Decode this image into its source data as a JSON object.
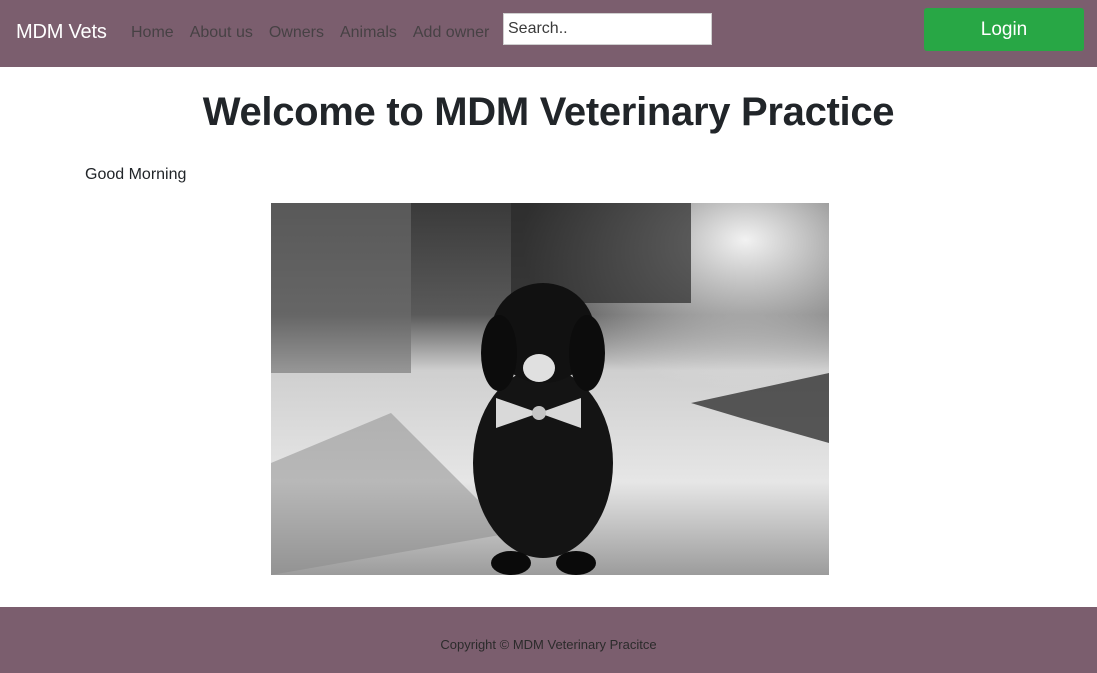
{
  "navbar": {
    "brand": "MDM Vets",
    "links": [
      {
        "label": "Home"
      },
      {
        "label": "About us"
      },
      {
        "label": "Owners"
      },
      {
        "label": "Animals"
      },
      {
        "label": "Add owner"
      }
    ],
    "search": {
      "placeholder": "Search..",
      "value": ""
    },
    "login_label": "Login"
  },
  "main": {
    "title": "Welcome to MDM Veterinary Practice",
    "greeting": "Good Morning",
    "hero_image": "black-puppy-with-bow-tie-photo"
  },
  "footer": {
    "copyright": "Copyright © MDM Veterinary Pracitce"
  },
  "colors": {
    "navbar_bg": "#7b5e6e",
    "login_bg": "#28a745",
    "text": "#212529"
  }
}
